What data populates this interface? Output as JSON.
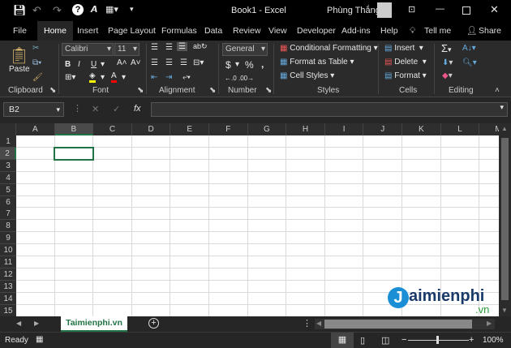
{
  "title_bar": {
    "title": "Book1  -  Excel",
    "user": "Phùng Thắng"
  },
  "tabs": [
    "File",
    "Home",
    "Insert",
    "Page Layout",
    "Formulas",
    "Data",
    "Review",
    "View",
    "Developer",
    "Add-ins",
    "Help",
    "Tell me",
    "Share"
  ],
  "active_tab": "Home",
  "ribbon": {
    "clipboard": {
      "label": "Clipboard",
      "paste": "Paste"
    },
    "font": {
      "label": "Font",
      "name": "Calibri",
      "size": "11",
      "bold": "B",
      "italic": "I",
      "underline": "U",
      "fill_color": "#ffff00",
      "font_color": "#ff0000"
    },
    "alignment": {
      "label": "Alignment"
    },
    "number": {
      "label": "Number",
      "format": "General",
      "currency": "$",
      "percent": "%",
      "comma": ","
    },
    "styles": {
      "label": "Styles",
      "conditional": "Conditional Formatting",
      "format_table": "Format as Table",
      "cell_styles": "Cell Styles"
    },
    "cells": {
      "label": "Cells",
      "insert": "Insert",
      "delete": "Delete",
      "format": "Format"
    },
    "editing": {
      "label": "Editing"
    }
  },
  "formula_bar": {
    "name_box": "B2",
    "fx": "fx",
    "value": ""
  },
  "columns": [
    "A",
    "B",
    "C",
    "D",
    "E",
    "F",
    "G",
    "H",
    "I",
    "J",
    "K",
    "L",
    "M"
  ],
  "rows": [
    "1",
    "2",
    "3",
    "4",
    "5",
    "6",
    "7",
    "8",
    "9",
    "10",
    "11",
    "12",
    "13",
    "14",
    "15"
  ],
  "selected_cell": "B2",
  "sheet_tab": "Taimienphi.vn",
  "status": {
    "ready": "Ready",
    "zoom": "100%"
  },
  "watermark": "Taimienphi.vn"
}
